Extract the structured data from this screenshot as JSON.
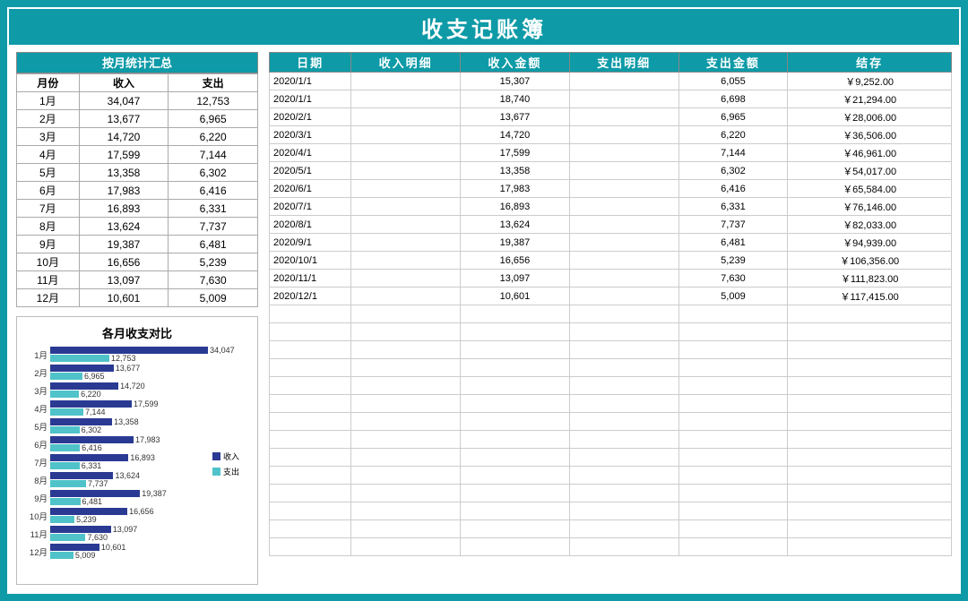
{
  "title": "收支记账簿",
  "summary": {
    "header": "按月统计汇总",
    "columns": [
      "月份",
      "收入",
      "支出"
    ],
    "rows": [
      {
        "month": "1月",
        "income": "34,047",
        "expense": "12,753"
      },
      {
        "month": "2月",
        "income": "13,677",
        "expense": "6,965"
      },
      {
        "month": "3月",
        "income": "14,720",
        "expense": "6,220"
      },
      {
        "month": "4月",
        "income": "17,599",
        "expense": "7,144"
      },
      {
        "month": "5月",
        "income": "13,358",
        "expense": "6,302"
      },
      {
        "month": "6月",
        "income": "17,983",
        "expense": "6,416"
      },
      {
        "month": "7月",
        "income": "16,893",
        "expense": "6,331"
      },
      {
        "month": "8月",
        "income": "13,624",
        "expense": "7,737"
      },
      {
        "month": "9月",
        "income": "19,387",
        "expense": "6,481"
      },
      {
        "month": "10月",
        "income": "16,656",
        "expense": "5,239"
      },
      {
        "month": "11月",
        "income": "13,097",
        "expense": "7,630"
      },
      {
        "month": "12月",
        "income": "10,601",
        "expense": "5,009"
      }
    ]
  },
  "detail": {
    "columns": [
      "日期",
      "收入明细",
      "收入金额",
      "支出明细",
      "支出金额",
      "结存"
    ],
    "rows": [
      {
        "date": "2020/1/1",
        "income_desc": "",
        "income_amt": "15,307",
        "expense_desc": "",
        "expense_amt": "6,055",
        "balance": "￥9,252.00"
      },
      {
        "date": "2020/1/1",
        "income_desc": "",
        "income_amt": "18,740",
        "expense_desc": "",
        "expense_amt": "6,698",
        "balance": "￥21,294.00"
      },
      {
        "date": "2020/2/1",
        "income_desc": "",
        "income_amt": "13,677",
        "expense_desc": "",
        "expense_amt": "6,965",
        "balance": "￥28,006.00"
      },
      {
        "date": "2020/3/1",
        "income_desc": "",
        "income_amt": "14,720",
        "expense_desc": "",
        "expense_amt": "6,220",
        "balance": "￥36,506.00"
      },
      {
        "date": "2020/4/1",
        "income_desc": "",
        "income_amt": "17,599",
        "expense_desc": "",
        "expense_amt": "7,144",
        "balance": "￥46,961.00"
      },
      {
        "date": "2020/5/1",
        "income_desc": "",
        "income_amt": "13,358",
        "expense_desc": "",
        "expense_amt": "6,302",
        "balance": "￥54,017.00"
      },
      {
        "date": "2020/6/1",
        "income_desc": "",
        "income_amt": "17,983",
        "expense_desc": "",
        "expense_amt": "6,416",
        "balance": "￥65,584.00"
      },
      {
        "date": "2020/7/1",
        "income_desc": "",
        "income_amt": "16,893",
        "expense_desc": "",
        "expense_amt": "6,331",
        "balance": "￥76,146.00"
      },
      {
        "date": "2020/8/1",
        "income_desc": "",
        "income_amt": "13,624",
        "expense_desc": "",
        "expense_amt": "7,737",
        "balance": "￥82,033.00"
      },
      {
        "date": "2020/9/1",
        "income_desc": "",
        "income_amt": "19,387",
        "expense_desc": "",
        "expense_amt": "6,481",
        "balance": "￥94,939.00"
      },
      {
        "date": "2020/10/1",
        "income_desc": "",
        "income_amt": "16,656",
        "expense_desc": "",
        "expense_amt": "5,239",
        "balance": "￥106,356.00"
      },
      {
        "date": "2020/11/1",
        "income_desc": "",
        "income_amt": "13,097",
        "expense_desc": "",
        "expense_amt": "7,630",
        "balance": "￥111,823.00"
      },
      {
        "date": "2020/12/1",
        "income_desc": "",
        "income_amt": "10,601",
        "expense_desc": "",
        "expense_amt": "5,009",
        "balance": "￥117,415.00"
      }
    ],
    "empty_rows": 14
  },
  "chart_data": {
    "type": "bar",
    "title": "各月收支对比",
    "orientation": "horizontal",
    "categories": [
      "1月",
      "2月",
      "3月",
      "4月",
      "5月",
      "6月",
      "7月",
      "8月",
      "9月",
      "10月",
      "11月",
      "12月"
    ],
    "series": [
      {
        "name": "收入",
        "color": "#2a3a93",
        "values": [
          34047,
          13677,
          14720,
          17599,
          13358,
          17983,
          16893,
          13624,
          19387,
          16656,
          13097,
          10601
        ]
      },
      {
        "name": "支出",
        "color": "#4fc3c9",
        "values": [
          12753,
          6965,
          6220,
          7144,
          6302,
          6416,
          6331,
          7737,
          6481,
          5239,
          7630,
          5009
        ]
      }
    ],
    "xlim": [
      0,
      35000
    ],
    "legend": [
      "收入",
      "支出"
    ]
  }
}
